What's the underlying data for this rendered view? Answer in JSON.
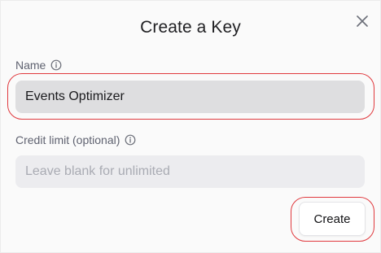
{
  "dialog": {
    "title": "Create a Key",
    "close_icon": "close-icon"
  },
  "fields": {
    "name": {
      "label": "Name",
      "value": "Events Optimizer",
      "info_icon": "info-icon"
    },
    "credit_limit": {
      "label": "Credit limit (optional)",
      "value": "",
      "placeholder": "Leave blank for unlimited",
      "info_icon": "info-icon"
    }
  },
  "actions": {
    "create_label": "Create"
  },
  "colors": {
    "highlight_ring": "#e0393e",
    "input_filled_bg": "#dedee0",
    "input_empty_bg": "#ececef"
  }
}
